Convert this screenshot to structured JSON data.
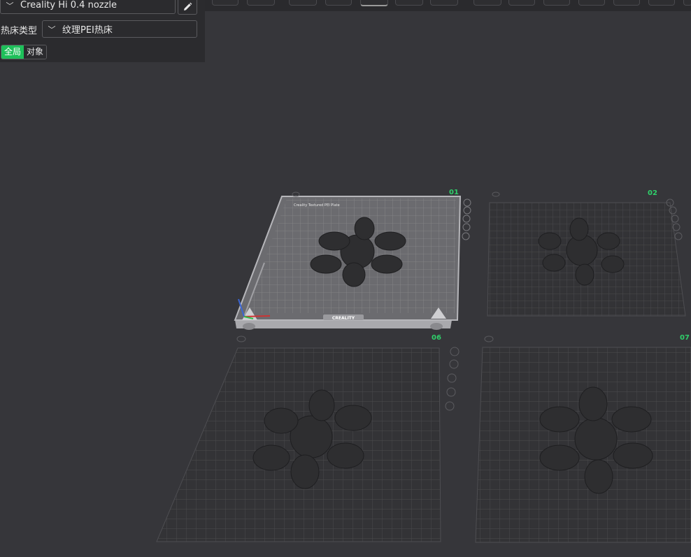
{
  "printer": {
    "name": "Creality Hi 0.4 nozzle"
  },
  "bed": {
    "label": "热床类型",
    "value": "纹理PEI热床"
  },
  "scope_toggle": {
    "global": "全局",
    "object": "对象",
    "selected": "全局"
  },
  "plates": [
    {
      "number": "01",
      "active": true
    },
    {
      "number": "02",
      "active": false
    },
    {
      "number": "06",
      "active": false
    },
    {
      "number": "07",
      "active": false
    }
  ],
  "bed_branding": {
    "plate_title": "Creality Textured PEI Plate",
    "logo": "CREALITY"
  },
  "colors": {
    "accent": "#1ec05a",
    "background": "#36363a",
    "panel": "#2b2b2e",
    "model": "#2e2e30"
  }
}
